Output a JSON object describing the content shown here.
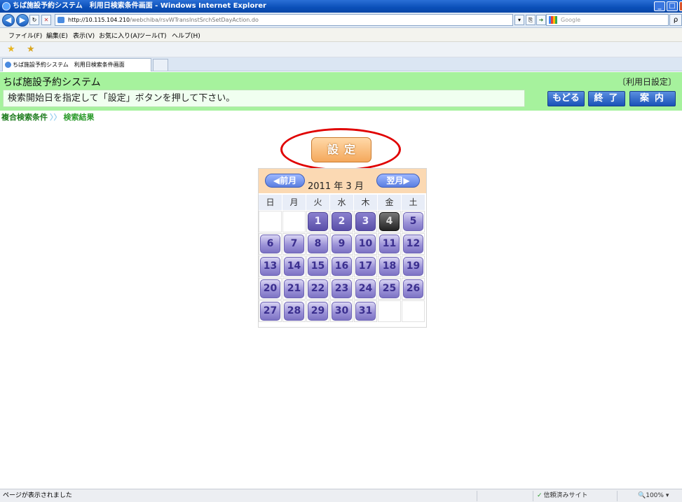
{
  "window": {
    "title": "ちば施設予約システム　利用日検索条件画面 - Windows Internet Explorer",
    "minimize": "_",
    "maximize": "□",
    "close": "✕"
  },
  "addressbar": {
    "back_icon": "◀",
    "forward_icon": "▶",
    "refresh": "↻",
    "stop": "✕",
    "url_host": "http://10.115.104.210",
    "url_path": "/webchiba/rsvWTransInstSrchSetDayAction.do",
    "search_placeholder": "Google",
    "search_btn": "ρ"
  },
  "menu": {
    "items": [
      "ファイル(F)",
      "編集(E)",
      "表示(V)",
      "お気に入り(A)",
      "ツール(T)",
      "ヘルプ(H)"
    ]
  },
  "tabs": [
    {
      "label": "ちば施設予約システム　利用日検索条件画面"
    }
  ],
  "header": {
    "app_name": "ちば施設予約システム",
    "screen_name": "〔利用日設定〕",
    "instruction": "検索開始日を指定して「設定」ボタンを押して下さい。",
    "buttons": {
      "back": "もどる",
      "exit": "終了",
      "guide": "案内"
    }
  },
  "breadcrumb": {
    "items": [
      "複合検索条件",
      "検索結果"
    ],
    "separator": "〉〉"
  },
  "set_button": {
    "label": "設定"
  },
  "calendar": {
    "prev": "◀前月",
    "next": "翌月▶",
    "year": "2011",
    "month": "3",
    "year_suffix": "年",
    "month_suffix": "月",
    "weekdays": [
      "日",
      "月",
      "火",
      "水",
      "木",
      "金",
      "土"
    ],
    "weeks": [
      [
        "",
        "",
        "1",
        "2",
        "3",
        "4",
        "5"
      ],
      [
        "6",
        "7",
        "8",
        "9",
        "10",
        "11",
        "12"
      ],
      [
        "13",
        "14",
        "15",
        "16",
        "17",
        "18",
        "19"
      ],
      [
        "20",
        "21",
        "22",
        "23",
        "24",
        "25",
        "26"
      ],
      [
        "27",
        "28",
        "29",
        "30",
        "31",
        "",
        ""
      ]
    ],
    "past_days": [
      "1",
      "2",
      "3"
    ],
    "selected_day": "4"
  },
  "status": {
    "text": "ページが表示されました",
    "zone": "信頼済みサイト",
    "zoom": "100%"
  },
  "colors": {
    "header_bg": "#a6f29d",
    "highlight_oval": "#e00000",
    "set_button": "#f4a85c"
  }
}
